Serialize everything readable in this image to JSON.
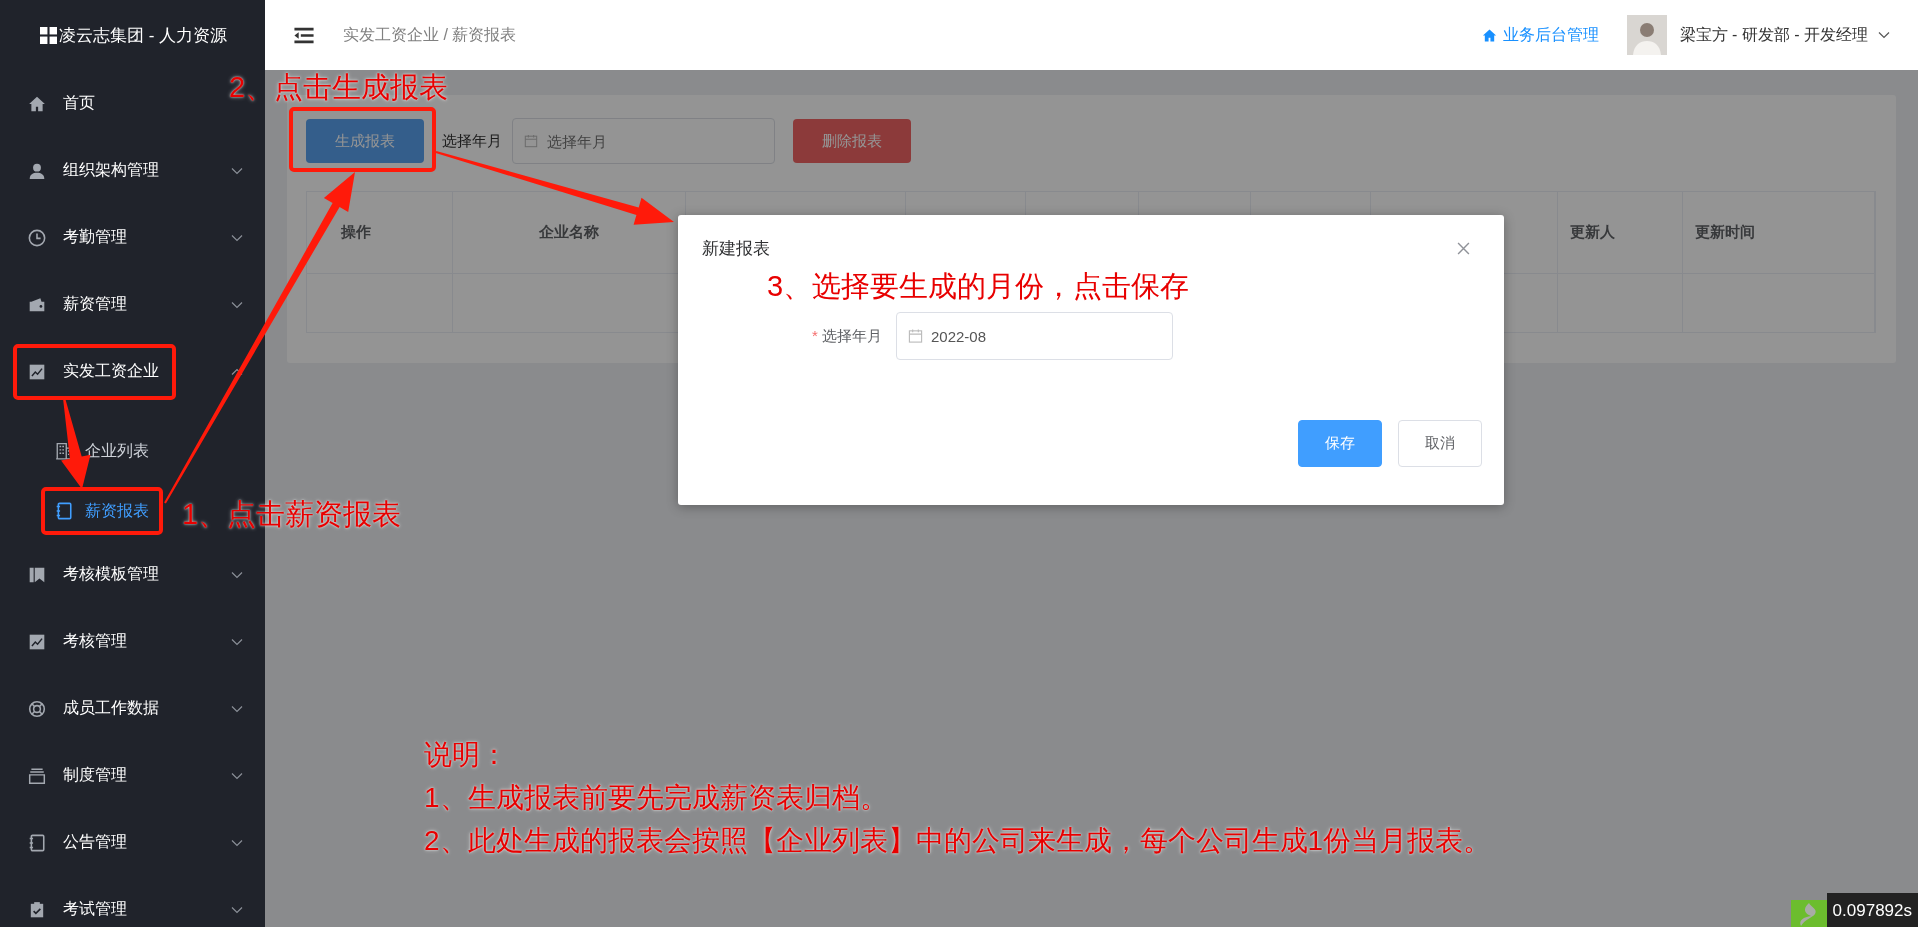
{
  "sidebar": {
    "logo": "凌云志集团 - 人力资源",
    "items": [
      {
        "label": "首页",
        "kind": "link"
      },
      {
        "label": "组织架构管理",
        "kind": "submenu",
        "expanded": false
      },
      {
        "label": "考勤管理",
        "kind": "submenu",
        "expanded": false
      },
      {
        "label": "薪资管理",
        "kind": "submenu",
        "expanded": false
      },
      {
        "label": "实发工资企业",
        "kind": "submenu",
        "expanded": true,
        "children": [
          {
            "label": "企业列表",
            "selected": false
          },
          {
            "label": "薪资报表",
            "selected": true
          }
        ]
      },
      {
        "label": "考核模板管理",
        "kind": "submenu",
        "expanded": false
      },
      {
        "label": "考核管理",
        "kind": "submenu",
        "expanded": false
      },
      {
        "label": "成员工作数据",
        "kind": "submenu",
        "expanded": false
      },
      {
        "label": "制度管理",
        "kind": "submenu",
        "expanded": false
      },
      {
        "label": "公告管理",
        "kind": "submenu",
        "expanded": false
      },
      {
        "label": "考试管理",
        "kind": "submenu",
        "expanded": false
      }
    ]
  },
  "header": {
    "breadcrumb": "实发工资企业 / 薪资报表",
    "admin_link": "业务后台管理",
    "user": "梁宝方 - 研发部 - 开发经理"
  },
  "toolbar": {
    "generate_button": "生成报表",
    "month_label": "选择年月",
    "month_field": {
      "placeholder": "选择年月"
    },
    "delete_button": "删除报表"
  },
  "table": {
    "columns": [
      "操作",
      "企业名称",
      "更新人",
      "更新时间"
    ]
  },
  "dialog": {
    "title": "新建报表",
    "field": {
      "label": "选择年月",
      "required_mark": "*",
      "value": "2022-08"
    },
    "buttons": [
      {
        "label": "保存",
        "kind": "primary"
      },
      {
        "label": "取消",
        "kind": "default"
      }
    ]
  },
  "annotations": {
    "steps": [
      "2、点击生成报表",
      "1、点击薪资报表",
      "3、选择要生成的月份，点击保存"
    ],
    "notes": [
      "说明：",
      "1、生成报表前要先完成薪资表归档。",
      "2、此处生成的报表会按照【企业列表】中的公司来生成，每个公司生成1份当月报表。"
    ]
  },
  "debug_timer": "0.097892s"
}
